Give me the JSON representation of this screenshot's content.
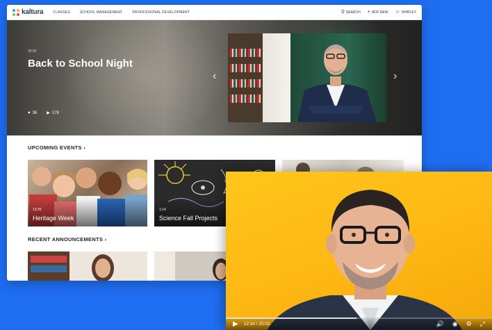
{
  "nav": {
    "logo_text": "kaltura",
    "items": [
      "CLASSES",
      "SCHOOL MANAGEMENT",
      "PROFESSIONAL DEVELOPMENT"
    ],
    "search_label": "SEARCH",
    "add_new_label": "ADD NEW",
    "user_label": "SHIRLEY"
  },
  "hero": {
    "duration": "25:02",
    "title": "Back to School Night",
    "likes": "36",
    "views": "178"
  },
  "upcoming": {
    "title": "UPCOMING EVENTS",
    "cards": [
      {
        "time": "13:25",
        "title": "Heritage Week"
      },
      {
        "time": "1:14",
        "title": "Science Fall Projects"
      }
    ]
  },
  "announcements": {
    "title": "RECENT ANNOUNCEMENTS"
  },
  "player": {
    "time": "12:34 / 25:02",
    "progress": 0.49
  },
  "colors": {
    "background": "#1f6df0",
    "player_bg": "#fdb714"
  }
}
